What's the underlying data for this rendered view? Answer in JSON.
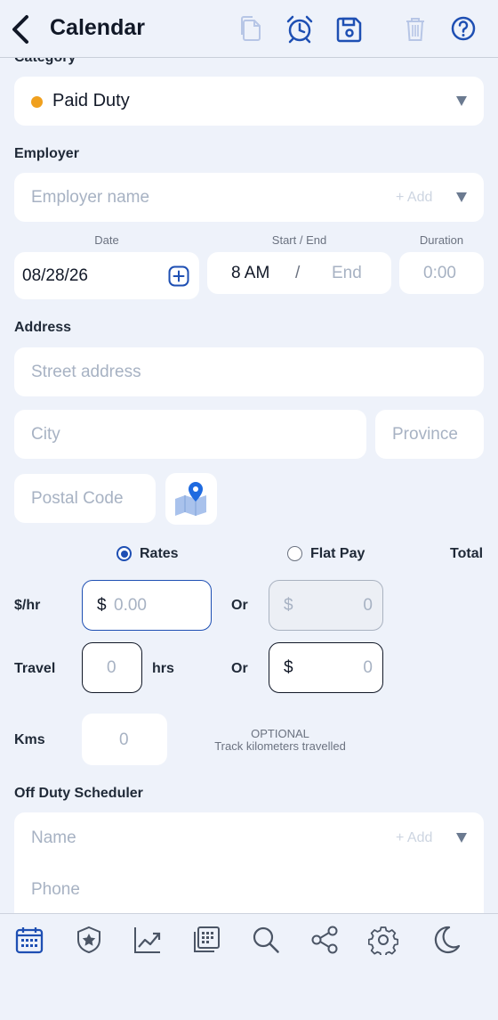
{
  "header": {
    "title": "Calendar",
    "icons": [
      "back-chevron-icon",
      "copy-icon",
      "alarm-clock-icon",
      "save-icon",
      "trash-icon",
      "help-icon"
    ]
  },
  "category": {
    "label": "Category",
    "value": "Paid Duty",
    "dot_color": "#f0a01e"
  },
  "employer": {
    "label": "Employer",
    "placeholder": "Employer name",
    "add_label": "+ Add"
  },
  "schedule": {
    "date_label": "Date",
    "date_value": "08/28/26",
    "start_end_label": "Start / End",
    "start_value": "8 AM",
    "separator": "/",
    "end_placeholder": "End",
    "duration_label": "Duration",
    "duration_value": "0:00"
  },
  "address": {
    "label": "Address",
    "street_placeholder": "Street address",
    "city_placeholder": "City",
    "province_placeholder": "Province",
    "postal_placeholder": "Postal Code"
  },
  "pay": {
    "rates_label": "Rates",
    "flat_label": "Flat Pay",
    "total_label": "Total",
    "selected": "Rates",
    "hourly_label": "$/hr",
    "hourly_prefix": "$",
    "hourly_placeholder": "0.00",
    "or_label": "Or",
    "flat_prefix": "$",
    "flat_value": "0",
    "travel_label": "Travel",
    "travel_hours": "0",
    "hrs_label": "hrs",
    "travel_prefix": "$",
    "travel_amount": "0",
    "kms_label": "Kms",
    "kms_value": "0",
    "optional_label": "OPTIONAL",
    "optional_hint": "Track kilometers travelled"
  },
  "off_duty": {
    "label": "Off Duty Scheduler",
    "name_placeholder": "Name",
    "add_label": "+ Add",
    "phone_placeholder": "Phone"
  },
  "tabbar": {
    "icons": [
      "calendar-icon",
      "badge-star-icon",
      "chart-icon",
      "reports-icon",
      "search-icon",
      "share-icon",
      "settings-icon",
      "moon-icon"
    ]
  },
  "colors": {
    "accent": "#1e4fb3",
    "background": "#eef2fa",
    "placeholder": "#a7b2c3"
  }
}
